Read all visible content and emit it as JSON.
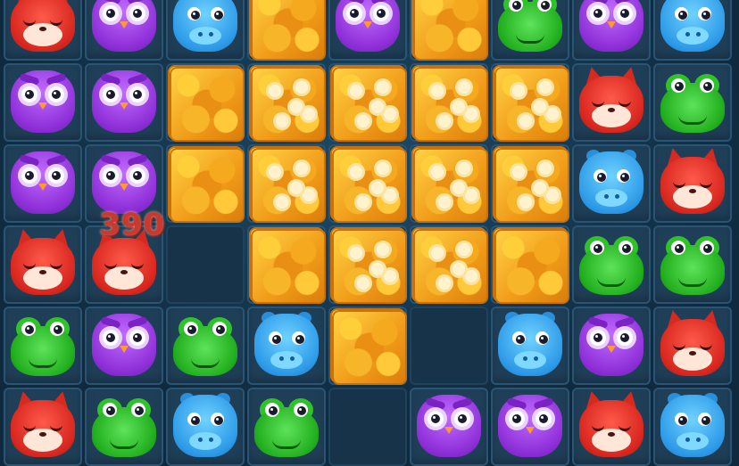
{
  "game": {
    "score_popup": "390",
    "colors": {
      "board": "#0f2a3e",
      "owl": "#8e2fd8",
      "fox": "#d8271f",
      "frog": "#23b01f",
      "hippo": "#2e9be8",
      "leaf_block": "#f5a91e"
    },
    "grid": {
      "cols": 9,
      "rows": 6,
      "cells": [
        [
          "fox",
          "owl",
          "hippo",
          "leaf",
          "owl",
          "leaf",
          "frog",
          "owl",
          "hippo"
        ],
        [
          "owl",
          "owl",
          "leaf",
          "leaf-flower",
          "leaf-flower",
          "leaf-flower",
          "leaf-flower",
          "fox",
          "frog"
        ],
        [
          "owl",
          "owl",
          "leaf",
          "leaf-flower",
          "leaf-flower",
          "leaf-flower",
          "leaf-flower",
          "hippo",
          "fox"
        ],
        [
          "fox",
          "fox",
          "empty",
          "leaf",
          "leaf-flower",
          "leaf-flower",
          "leaf",
          "frog",
          "frog"
        ],
        [
          "frog",
          "owl",
          "frog",
          "hippo",
          "leaf",
          "empty",
          "hippo",
          "owl",
          "fox"
        ],
        [
          "fox",
          "frog",
          "hippo",
          "frog",
          "empty",
          "owl",
          "owl",
          "fox",
          "hippo"
        ]
      ]
    }
  }
}
